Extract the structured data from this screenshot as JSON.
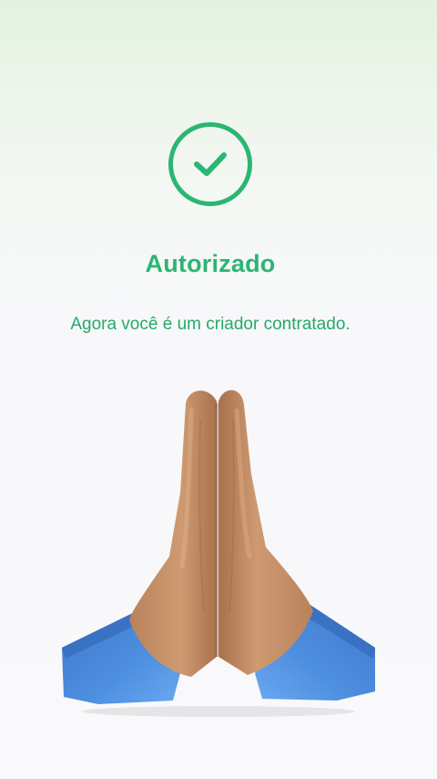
{
  "status": {
    "title": "Autorizado",
    "message": "Agora você é um criador contratado.",
    "icon": "check-circle-icon",
    "illustration": "folded-hands-icon"
  },
  "colors": {
    "accent": "#2bb673",
    "message": "#27a86a",
    "sleeve": "#4a86d8",
    "skin": "#c8926a"
  }
}
